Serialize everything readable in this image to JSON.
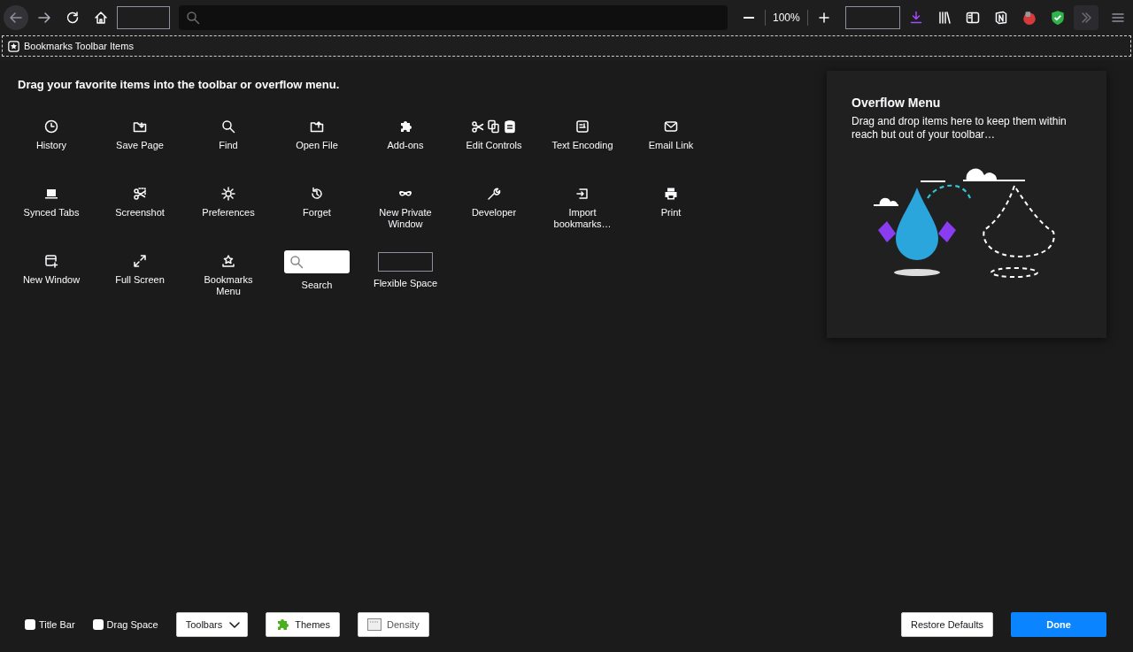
{
  "toolbar": {
    "zoom_level": "100%"
  },
  "bookmarks_toolbar": {
    "label": "Bookmarks Toolbar Items"
  },
  "palette": {
    "heading": "Drag your favorite items into the toolbar or overflow menu.",
    "items": [
      {
        "label": "History",
        "kind": "button"
      },
      {
        "label": "Save Page",
        "kind": "button"
      },
      {
        "label": "Find",
        "kind": "button"
      },
      {
        "label": "Open File",
        "kind": "button"
      },
      {
        "label": "Add-ons",
        "kind": "button"
      },
      {
        "label": "Edit Controls",
        "kind": "button"
      },
      {
        "label": "Text Encoding",
        "kind": "button"
      },
      {
        "label": "Email Link",
        "kind": "button"
      },
      {
        "label": "Synced Tabs",
        "kind": "button"
      },
      {
        "label": "Screenshot",
        "kind": "button"
      },
      {
        "label": "Preferences",
        "kind": "button"
      },
      {
        "label": "Forget",
        "kind": "button"
      },
      {
        "label": "New Private Window",
        "kind": "button"
      },
      {
        "label": "Developer",
        "kind": "button"
      },
      {
        "label": "Import bookmarks…",
        "kind": "button"
      },
      {
        "label": "Print",
        "kind": "button"
      },
      {
        "label": "New Window",
        "kind": "button"
      },
      {
        "label": "Full Screen",
        "kind": "button"
      },
      {
        "label": "Bookmarks Menu",
        "kind": "button"
      },
      {
        "label": "Search",
        "kind": "search"
      },
      {
        "label": "Flexible Space",
        "kind": "space"
      }
    ]
  },
  "overflow_menu": {
    "title": "Overflow Menu",
    "text": "Drag and drop items here to keep them within reach but out of your toolbar…"
  },
  "footer": {
    "checkboxes": [
      {
        "label": "Title Bar",
        "checked": false
      },
      {
        "label": "Drag Space",
        "checked": false
      }
    ],
    "toolbars_dropdown": "Toolbars",
    "themes_button": "Themes",
    "density_button": "Density",
    "restore_button": "Restore Defaults",
    "done_button": "Done"
  }
}
